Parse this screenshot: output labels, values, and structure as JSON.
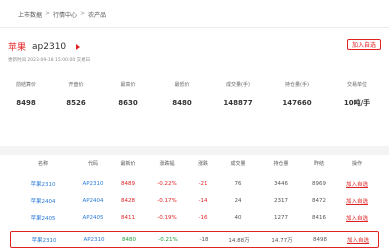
{
  "breadcrumb": [
    "上市数据",
    "行情中心",
    "农产品"
  ],
  "header": {
    "name": "苹果",
    "code": "ap2310",
    "update_time": "更新时间 2023-09-18 15:00:00 交易日",
    "add_button": "加入自选"
  },
  "stats": [
    {
      "label": "前结算价",
      "value": "8498"
    },
    {
      "label": "开盘价",
      "value": "8526"
    },
    {
      "label": "最高价",
      "value": "8630"
    },
    {
      "label": "最低价",
      "value": "8480"
    },
    {
      "label": "成交量(手)",
      "value": "148877"
    },
    {
      "label": "持仓量(手)",
      "value": "147660"
    },
    {
      "label": "交易单位",
      "value": "10吨/手"
    }
  ],
  "table": {
    "headers": [
      "名称",
      "代码",
      "最新价",
      "涨跌幅",
      "涨跌",
      "成交量",
      "持仓量",
      "昨结",
      "操作"
    ],
    "rows": [
      {
        "name": "苹果2310",
        "code": "AP2310",
        "price": "8489",
        "change_pct": "-0.22%",
        "change": "-21",
        "volume": "76",
        "open_interest": "3446",
        "prev_settle": "8969",
        "action": "加入自选",
        "selected": false
      },
      {
        "name": "苹果2404",
        "code": "AP2404",
        "price": "8428",
        "change_pct": "-0.17%",
        "change": "-14",
        "volume": "24",
        "open_interest": "2317",
        "prev_settle": "8472",
        "action": "加入自选",
        "selected": false
      },
      {
        "name": "苹果2405",
        "code": "AP2405",
        "price": "8411",
        "change_pct": "-0.19%",
        "change": "-16",
        "volume": "40",
        "open_interest": "1277",
        "prev_settle": "8416",
        "action": "加入自选",
        "selected": false
      },
      {
        "name": "苹果2310",
        "code": "AP2310",
        "price": "8480",
        "change_pct": "-0.21%",
        "change": "-18",
        "volume": "14.88万",
        "open_interest": "14.77万",
        "prev_settle": "8498",
        "action": "加入自选",
        "selected": true
      }
    ]
  }
}
